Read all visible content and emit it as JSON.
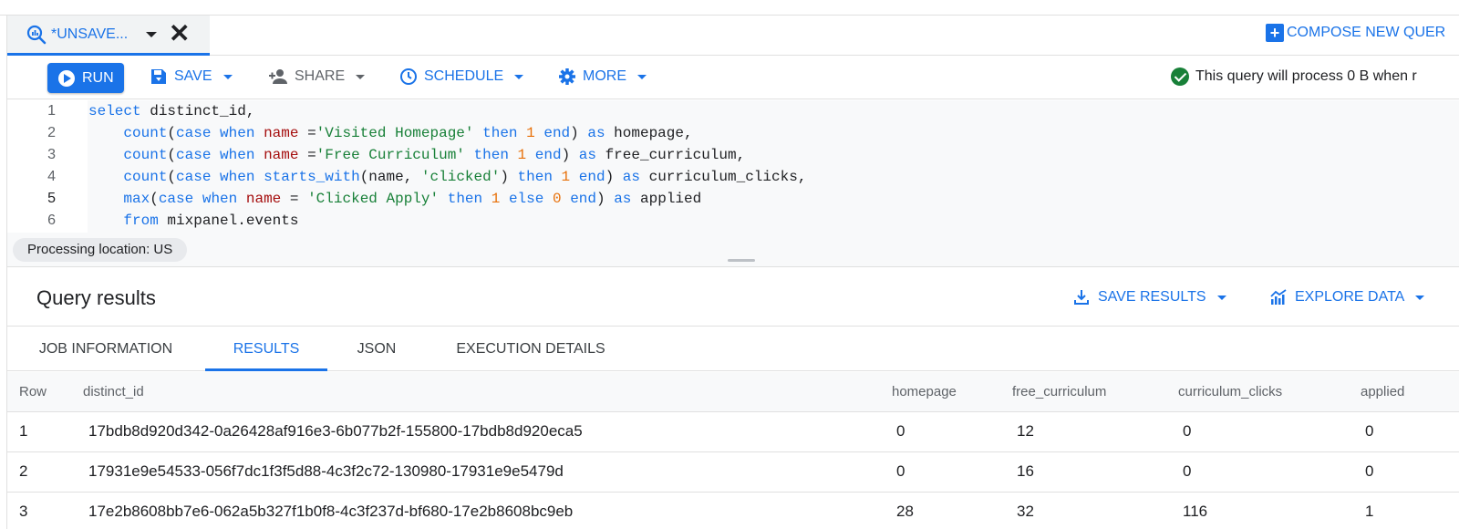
{
  "tab": {
    "title": "*UNSAVE..."
  },
  "compose": {
    "label": "COMPOSE NEW QUER"
  },
  "toolbar": {
    "run": "RUN",
    "save": "SAVE",
    "share": "SHARE",
    "schedule": "SCHEDULE",
    "more": "MORE",
    "status": "This query will process 0 B when r"
  },
  "editor": {
    "line_numbers": [
      "1",
      "2",
      "3",
      "4",
      "5",
      "6"
    ],
    "processing_location": "Processing location: US"
  },
  "results": {
    "title": "Query results",
    "save_results": "SAVE RESULTS",
    "explore_data": "EXPLORE DATA",
    "tabs": [
      "JOB INFORMATION",
      "RESULTS",
      "JSON",
      "EXECUTION DETAILS"
    ],
    "active_tab": "RESULTS",
    "columns": [
      "Row",
      "distinct_id",
      "homepage",
      "free_curriculum",
      "curriculum_clicks",
      "applied"
    ],
    "rows": [
      [
        "1",
        "17bdb8d920d342-0a26428af916e3-6b077b2f-155800-17bdb8d920eca5",
        "0",
        "12",
        "0",
        "0"
      ],
      [
        "2",
        "17931e9e54533-056f7dc1f3f5d88-4c3f2c72-130980-17931e9e5479d",
        "0",
        "16",
        "0",
        "0"
      ],
      [
        "3",
        "17e2b8608bb7e6-062a5b327f1b0f8-4c3f237d-bf680-17e2b8608bc9eb",
        "28",
        "32",
        "116",
        "1"
      ]
    ]
  },
  "colors": {
    "accent": "#1a73e8",
    "success": "#188038",
    "keyword": "#1a73e8",
    "string": "#188038",
    "number": "#e8710a",
    "identifier": "#a50e0e"
  }
}
